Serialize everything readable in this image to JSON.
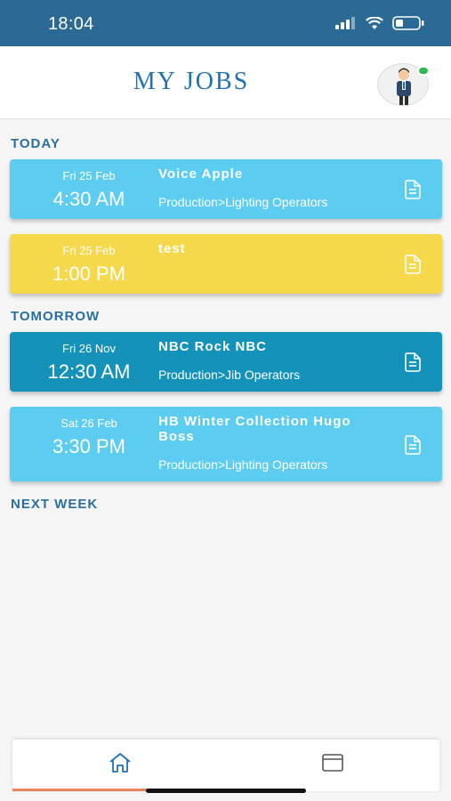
{
  "status_bar": {
    "time": "18:04",
    "icons": [
      "signal-icon",
      "wifi-icon",
      "battery-icon"
    ]
  },
  "header": {
    "title": "MY JOBS",
    "avatar": "avatar"
  },
  "sections": {
    "today": "TODAY",
    "tomorrow": "TOMORROW",
    "next_week": "NEXT WEEK"
  },
  "jobs": [
    {
      "date": "Fri 25 Feb",
      "time": "4:30 AM",
      "title": "Voice Apple",
      "category": "Production>Lighting Operators",
      "color": "#5ccdf0"
    },
    {
      "date": "Fri 25 Feb",
      "time": "1:00 PM",
      "title": "test",
      "category": "",
      "color": "#f5d84c"
    },
    {
      "date": "Fri 26 Nov",
      "time": "12:30 AM",
      "title": "NBC Rock NBC",
      "category": "Production>Jib Operators",
      "color": "#1592b9"
    },
    {
      "date": "Sat 26 Feb",
      "time": "3:30 PM",
      "title": "HB Winter Collection Hugo Boss",
      "category": "Production>Lighting Operators",
      "color": "#5ccdf0"
    }
  ],
  "bottom_nav": {
    "items": [
      "home-icon",
      "calendar-icon"
    ],
    "active_color": "#e8845a"
  },
  "colors": {
    "status_bar": "#2b6a95",
    "title": "#1f72b6",
    "section_label": "#2a6f9e"
  }
}
